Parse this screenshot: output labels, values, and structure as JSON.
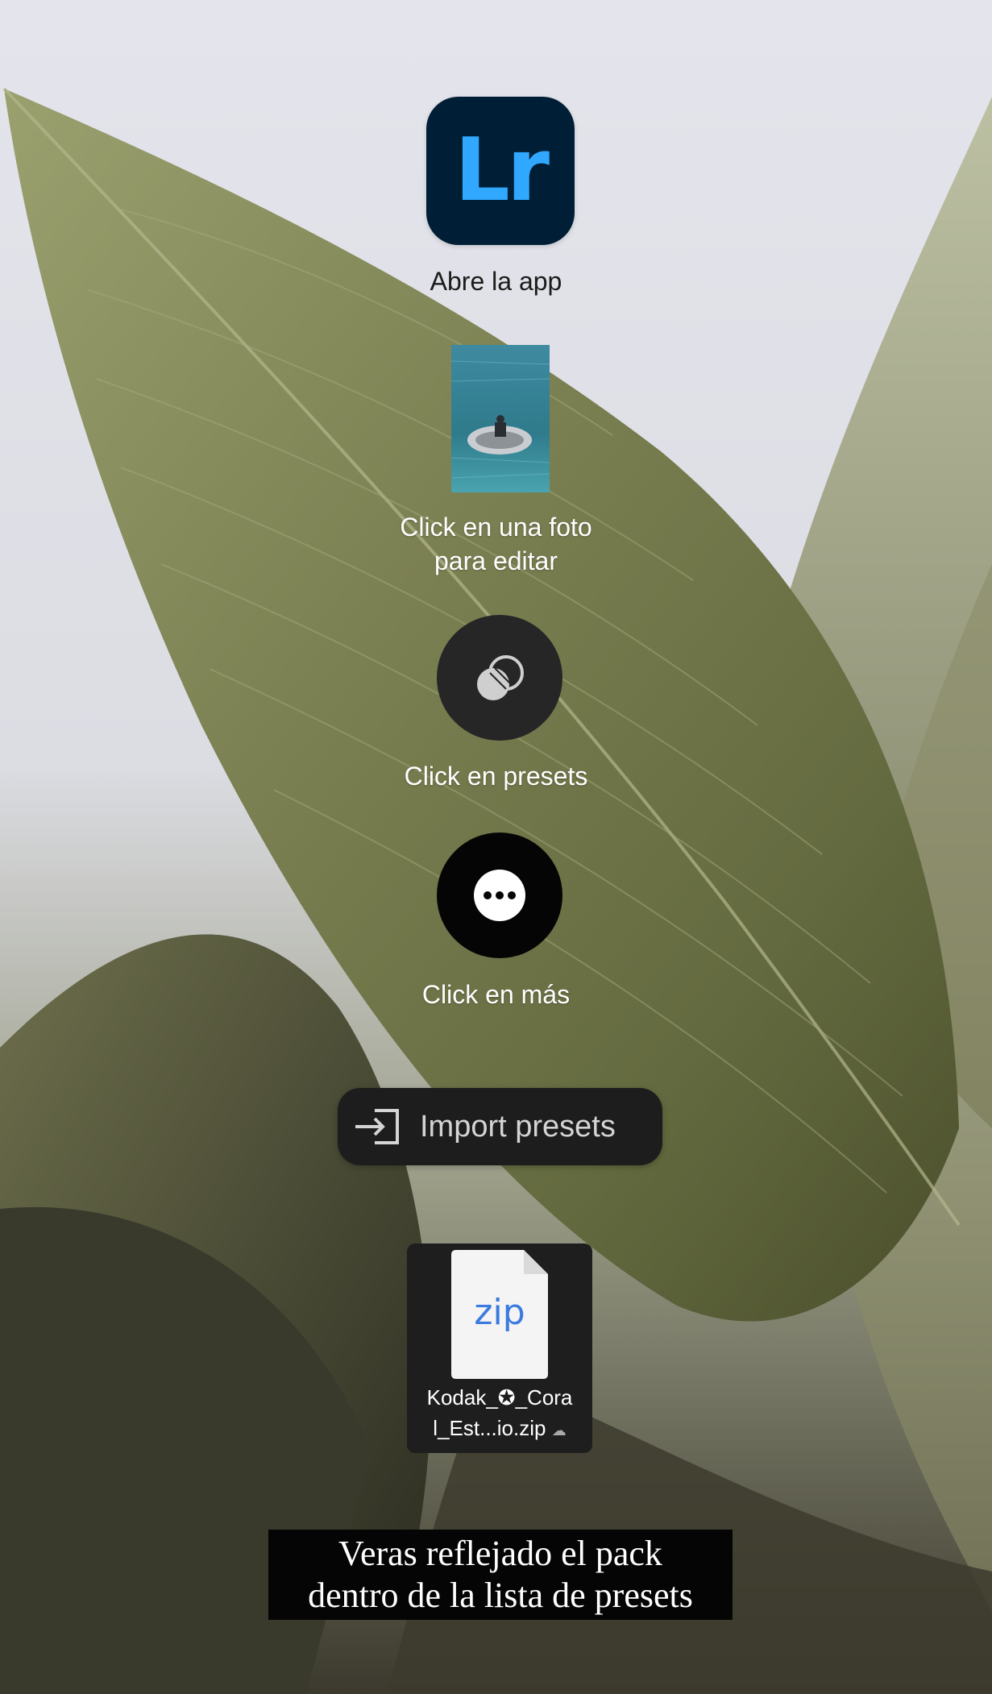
{
  "steps": {
    "open_app": {
      "icon_text": "Lr",
      "icon_name": "lightroom-app-icon",
      "label": "Abre la app"
    },
    "select_photo": {
      "thumbnail": "boat-photo-thumbnail",
      "label_line1": "Click en una foto",
      "label_line2": "para editar"
    },
    "presets": {
      "icon_name": "presets-icon",
      "label": "Click en presets"
    },
    "more": {
      "icon_name": "more-options-icon",
      "label": "Click en más"
    },
    "import": {
      "icon_name": "import-icon",
      "label": "Import presets"
    },
    "file": {
      "doc_text": "zip",
      "name_line1": "Kodak_✪_Cora",
      "name_line2": "l_Est...io.zip",
      "cloud_icon": "cloud-icon"
    }
  },
  "caption": {
    "line1": "Veras reflejado el pack",
    "line2": "dentro de la lista de presets"
  },
  "colors": {
    "lr_blue": "#31a8ff",
    "lr_bg": "#001e36",
    "zip_blue": "#3b7be0",
    "leaf": "#6e7548"
  }
}
